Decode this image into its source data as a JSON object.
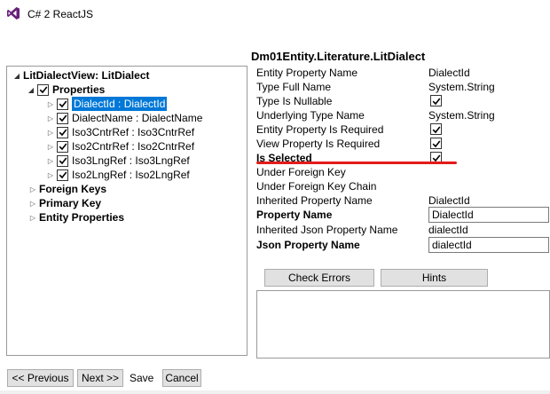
{
  "window": {
    "title": "C# 2 ReactJS",
    "logo_icon": "visual-studio-logo-icon",
    "accent": "#68217a"
  },
  "tree": {
    "root": {
      "label": "LitDialectView: LitDialect",
      "expanded": true
    },
    "properties": {
      "label": "Properties",
      "checked": true,
      "expanded": true
    },
    "items": [
      {
        "label": "DialectId : DialectId",
        "checked": true,
        "selected": true
      },
      {
        "label": "DialectName : DialectName",
        "checked": true,
        "selected": false
      },
      {
        "label": "Iso3CntrRef : Iso3CntrRef",
        "checked": true,
        "selected": false
      },
      {
        "label": "Iso2CntrRef : Iso2CntrRef",
        "checked": true,
        "selected": false
      },
      {
        "label": "Iso3LngRef : Iso3LngRef",
        "checked": true,
        "selected": false
      },
      {
        "label": "Iso2LngRef : Iso2LngRef",
        "checked": true,
        "selected": false
      }
    ],
    "groups": [
      {
        "label": "Foreign Keys"
      },
      {
        "label": "Primary Key"
      },
      {
        "label": "Entity Properties"
      }
    ],
    "selection_color": "#0078d7"
  },
  "properties_panel": {
    "title": "Dm01Entity.Literature.LitDialect",
    "rows": [
      {
        "label": "Entity Property Name",
        "value": "DialectId"
      },
      {
        "label": "Type Full Name",
        "value": "System.String"
      },
      {
        "label": "Type Is Nullable",
        "checked": true
      },
      {
        "label": "Underlying Type Name",
        "value": "System.String"
      },
      {
        "label": "Entity Property Is Required",
        "checked": true
      },
      {
        "label": "View Property Is Required",
        "checked": true
      },
      {
        "label": "Is Selected",
        "checked": true,
        "bold": true
      },
      {
        "label": "Under Foreign Key"
      },
      {
        "label": "Under Foreign Key Chain"
      },
      {
        "label": "Inherited Property Name",
        "value": "DialectId"
      },
      {
        "label": "Property Name",
        "input": "DialectId",
        "bold": true
      },
      {
        "label": "Inherited Json Property Name",
        "value": "dialectId"
      },
      {
        "label": "Json Property Name",
        "input": "dialectId",
        "bold": true
      }
    ],
    "highlight_color": "#e41b1b"
  },
  "buttons": {
    "check_errors": "Check Errors",
    "hints": "Hints",
    "previous": "<< Previous",
    "next": "Next >>",
    "save": "Save",
    "cancel": "Cancel"
  }
}
